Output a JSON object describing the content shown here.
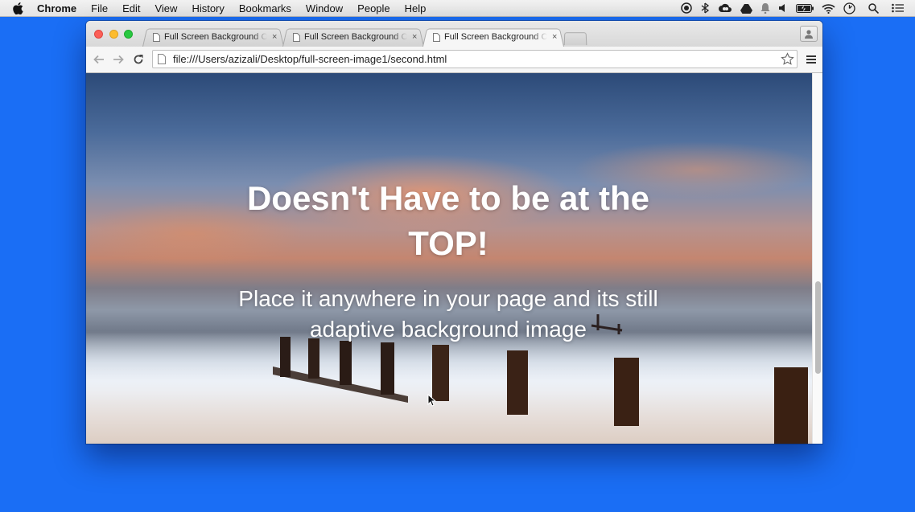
{
  "menubar": {
    "app_name": "Chrome",
    "items": [
      "File",
      "Edit",
      "View",
      "History",
      "Bookmarks",
      "Window",
      "People",
      "Help"
    ],
    "status_icons": [
      "record-icon",
      "bluetooth-icon",
      "creative-cloud-icon",
      "drive-icon",
      "notification-icon",
      "volume-icon",
      "battery-icon",
      "wifi-icon",
      "clock-icon",
      "spotlight-icon",
      "notification-center-icon"
    ]
  },
  "browser": {
    "tabs": [
      {
        "title": "Full Screen Background Cover Page",
        "active": false
      },
      {
        "title": "Full Screen Background Cover Page",
        "active": false
      },
      {
        "title": "Full Screen Background Cover Page",
        "active": true
      }
    ],
    "close_glyph": "×",
    "url": "file:///Users/azizali/Desktop/full-screen-image1/second.html",
    "scroll_position": 0.75,
    "scroll_visible_fraction": 0.25
  },
  "page": {
    "title": "Doesn't Have to be at the TOP!",
    "subtitle": "Place it anywhere in your page and its still adaptive background image"
  },
  "colors": {
    "desktop": "#1a6ef5",
    "heading": "#ffffff"
  }
}
